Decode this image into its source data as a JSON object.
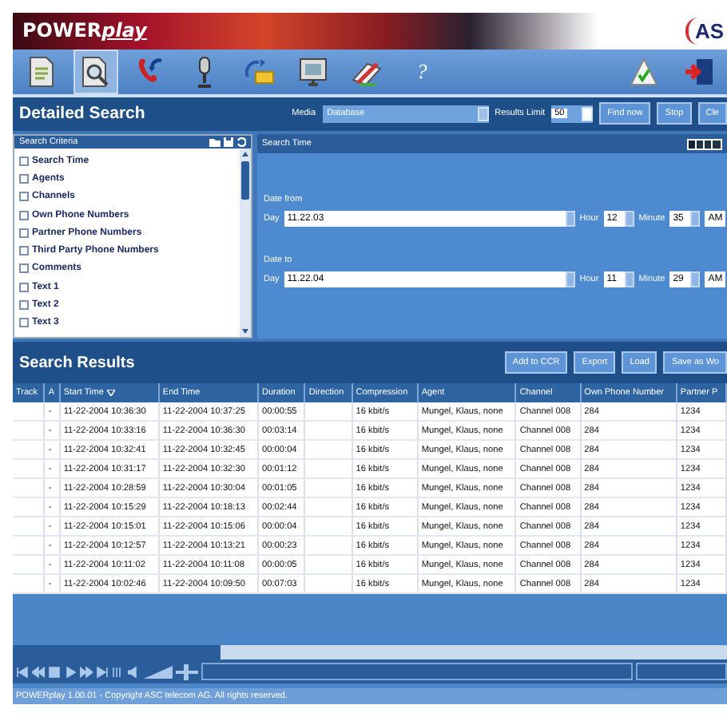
{
  "app": {
    "logo_main": "POWER",
    "logo_accent": "play",
    "corner_logo": "AS"
  },
  "toolbar": {
    "tools": [
      {
        "kind": "document",
        "selected": false
      },
      {
        "kind": "search-document",
        "selected": true
      },
      {
        "kind": "phone",
        "selected": false
      },
      {
        "kind": "microphone",
        "selected": false
      },
      {
        "kind": "arrows",
        "selected": false
      },
      {
        "kind": "monitor",
        "selected": false
      },
      {
        "kind": "pen",
        "selected": false
      },
      {
        "kind": "glyph",
        "text": "?",
        "selected": false
      }
    ]
  },
  "search_bar": {
    "title": "Detailed Search",
    "media_label": "Media",
    "media_value": "Database",
    "limit_label": "Results Limit",
    "limit_value": "50",
    "buttons": [
      "Find now",
      "Stop",
      "Cle"
    ]
  },
  "criteria": {
    "title": "Search Criteria",
    "items": [
      {
        "label": "Search Time",
        "checked": false
      },
      {
        "label": "Agents",
        "checked": false
      },
      {
        "label": "Channels",
        "checked": false
      },
      {
        "label": "Own Phone Numbers",
        "checked": false
      },
      {
        "label": "Partner Phone Numbers",
        "checked": false
      },
      {
        "label": "Third Party Phone Numbers",
        "checked": false
      },
      {
        "label": "Comments",
        "checked": false
      },
      {
        "label": "Text 1",
        "checked": false
      },
      {
        "label": "Text 2",
        "checked": false
      },
      {
        "label": "Text 3",
        "checked": false
      }
    ]
  },
  "search_time": {
    "title": "Search Time",
    "ranges": [
      {
        "label": "Date from",
        "day_label": "Day",
        "day": "11.22.03",
        "hour_label": "Hour",
        "hour": "12",
        "minute_label": "Minute",
        "minute": "35",
        "period": "AM"
      },
      {
        "label": "Date to",
        "day_label": "Day",
        "day": "11.22.04",
        "hour_label": "Hour",
        "hour": "11",
        "minute_label": "Minute",
        "minute": "29",
        "period": "AM"
      }
    ]
  },
  "results": {
    "title": "Search Results",
    "buttons": [
      "Add to CCR",
      "Export",
      "Load",
      "Save as Wo"
    ],
    "columns": [
      {
        "label": "Track",
        "sorted": false
      },
      {
        "label": "A",
        "sorted": false
      },
      {
        "label": "Start Time",
        "sorted": true
      },
      {
        "label": "End Time",
        "sorted": false
      },
      {
        "label": "Duration",
        "sorted": false
      },
      {
        "label": "Direction",
        "sorted": false
      },
      {
        "label": "Compression",
        "sorted": false
      },
      {
        "label": "Agent",
        "sorted": false
      },
      {
        "label": "Channel",
        "sorted": false
      },
      {
        "label": "Own Phone Number",
        "sorted": false
      },
      {
        "label": "Partner P",
        "sorted": false
      }
    ],
    "rows": [
      [
        "",
        "-",
        "11-22-2004 10:36:30",
        "11-22-2004 10:37:25",
        "00:00:55",
        "",
        "16 kbit/s",
        "Mungel, Klaus, none",
        "Channel 008",
        "284",
        "1234"
      ],
      [
        "",
        "-",
        "11-22-2004 10:33:16",
        "11-22-2004 10:36:30",
        "00:03:14",
        "",
        "16 kbit/s",
        "Mungel, Klaus, none",
        "Channel 008",
        "284",
        "1234"
      ],
      [
        "",
        "-",
        "11-22-2004 10:32:41",
        "11-22-2004 10:32:45",
        "00:00:04",
        "",
        "16 kbit/s",
        "Mungel, Klaus, none",
        "Channel 008",
        "284",
        "1234"
      ],
      [
        "",
        "-",
        "11-22-2004 10:31:17",
        "11-22-2004 10:32:30",
        "00:01:12",
        "",
        "16 kbit/s",
        "Mungel, Klaus, none",
        "Channel 008",
        "284",
        "1234"
      ],
      [
        "",
        "-",
        "11-22-2004 10:28:59",
        "11-22-2004 10:30:04",
        "00:01:05",
        "",
        "16 kbit/s",
        "Mungel, Klaus, none",
        "Channel 008",
        "284",
        "1234"
      ],
      [
        "",
        "-",
        "11-22-2004 10:15:29",
        "11-22-2004 10:18:13",
        "00:02:44",
        "",
        "16 kbit/s",
        "Mungel, Klaus, none",
        "Channel 008",
        "284",
        "1234"
      ],
      [
        "",
        "-",
        "11-22-2004 10:15:01",
        "11-22-2004 10:15:06",
        "00:00:04",
        "",
        "16 kbit/s",
        "Mungel, Klaus, none",
        "Channel 008",
        "284",
        "1234"
      ],
      [
        "",
        "-",
        "11-22-2004 10:12:57",
        "11-22-2004 10:13:21",
        "00:00:23",
        "",
        "16 kbit/s",
        "Mungel, Klaus, none",
        "Channel 008",
        "284",
        "1234"
      ],
      [
        "",
        "-",
        "11-22-2004 10:11:02",
        "11-22-2004 10:11:08",
        "00:00:05",
        "",
        "16 kbit/s",
        "Mungel, Klaus, none",
        "Channel 008",
        "284",
        "1234"
      ],
      [
        "",
        "-",
        "11-22-2004 10:02:46",
        "11-22-2004 10:09:50",
        "00:07:03",
        "",
        "16 kbit/s",
        "Mungel, Klaus, none",
        "Channel 008",
        "284",
        "1234"
      ]
    ]
  },
  "status_bar": "POWERplay 1.00.01 - Copyright ASC telecom AG. All rights reserved."
}
